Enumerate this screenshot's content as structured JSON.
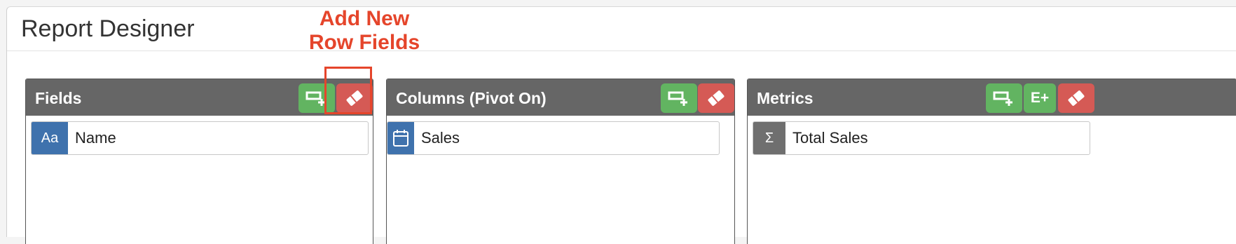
{
  "window": {
    "title": "Report Designer"
  },
  "annotation": {
    "line1": "Add New",
    "line2": "Row Fields",
    "color": "#e5452b"
  },
  "panels": [
    {
      "title": "Fields",
      "buttons": [
        {
          "icon": "add-row-icon",
          "color": "#62b461"
        },
        {
          "icon": "eraser-icon",
          "color": "#d55a55"
        }
      ],
      "items": [
        {
          "icon_text": "Aa",
          "label": "Name",
          "icon_color": "#3f72ad"
        }
      ]
    },
    {
      "title": "Columns (Pivot On)",
      "buttons": [
        {
          "icon": "add-column-icon",
          "color": "#62b461"
        },
        {
          "icon": "eraser-icon",
          "color": "#d55a55"
        }
      ],
      "items": [
        {
          "icon": "calendar-icon",
          "label": "Sales",
          "icon_color": "#3f72ad"
        }
      ]
    },
    {
      "title": "Metrics",
      "buttons": [
        {
          "icon": "add-metric-icon",
          "color": "#62b461"
        },
        {
          "label": "E+",
          "color": "#62b461"
        },
        {
          "icon": "eraser-icon",
          "color": "#d55a55"
        }
      ],
      "items": [
        {
          "icon_text": "Σ",
          "label": "Total Sales",
          "icon_color": "#6f6f6f"
        }
      ]
    }
  ]
}
